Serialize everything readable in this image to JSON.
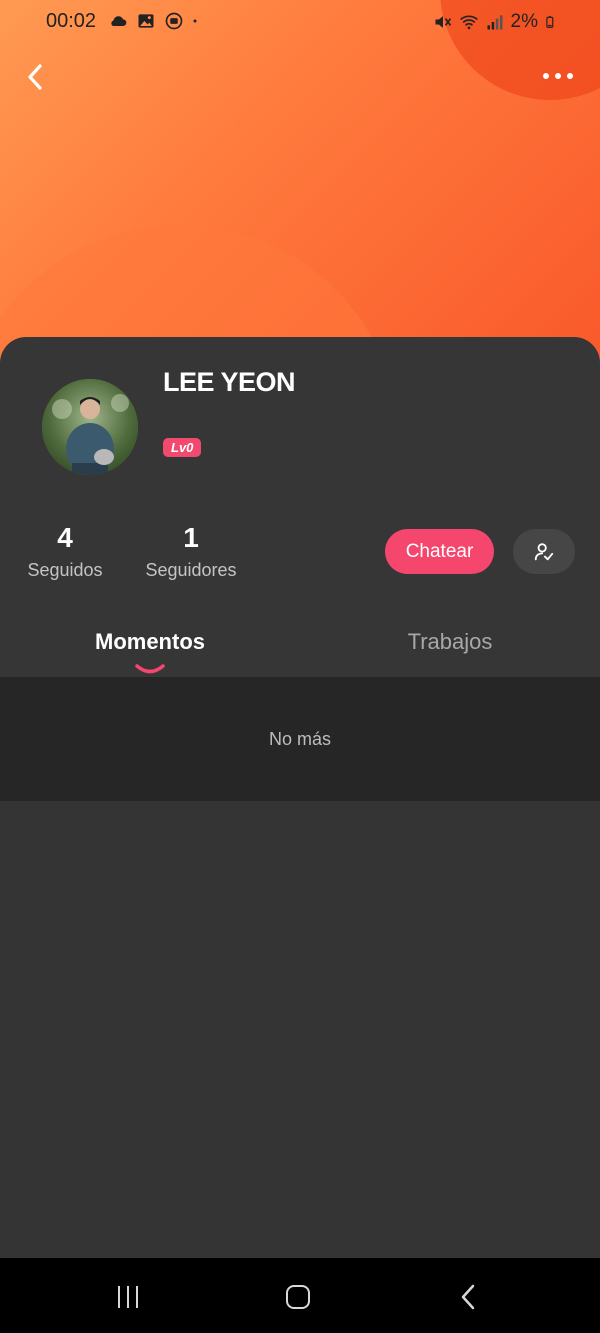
{
  "status_bar": {
    "time": "00:02",
    "battery_text": "2%",
    "left_icons": [
      "cloud-icon",
      "image-icon",
      "media-icon",
      "dot-icon"
    ],
    "right_icons": [
      "mute-icon",
      "wifi-icon",
      "signal-icon",
      "battery-icon"
    ]
  },
  "profile": {
    "name": "LEE YEON",
    "level": "Lv0",
    "following_count": "4",
    "following_label": "Seguidos",
    "followers_count": "1",
    "followers_label": "Seguidores",
    "chat_label": "Chatear"
  },
  "tabs": [
    {
      "label": "Momentos",
      "active": true
    },
    {
      "label": "Trabajos",
      "active": false
    }
  ],
  "content": {
    "empty_message": "No más"
  },
  "colors": {
    "accent": "#f5466e",
    "header_gradient_start": "#ff9a52",
    "header_gradient_end": "#f9582a",
    "background": "#333333"
  }
}
